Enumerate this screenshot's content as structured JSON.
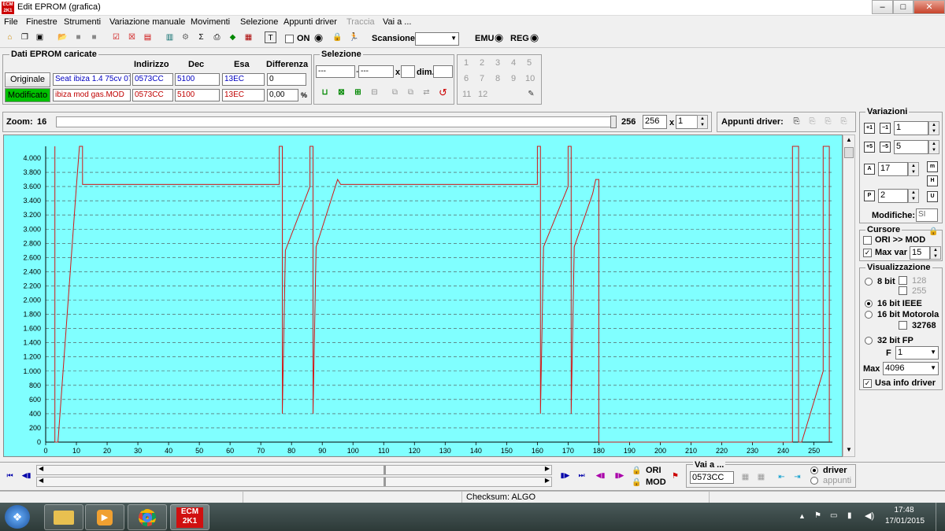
{
  "window": {
    "title": "Edit EPROM (grafica)",
    "app_icon_text": "ECM 2K1"
  },
  "menu": [
    "File",
    "Finestre",
    "Strumenti",
    "Variazione manuale",
    "Movimenti",
    "Selezione",
    "Appunti driver",
    "Traccia",
    "Vai a ..."
  ],
  "toolbar": {
    "on_label": "ON",
    "scansione_label": "Scansione",
    "scansione_value": "",
    "emu_label": "EMU",
    "reg_label": "REG"
  },
  "dati_eprom": {
    "group_title": "Dati EPROM caricate",
    "headers": {
      "indirizzo": "Indirizzo",
      "dec": "Dec",
      "esa": "Esa",
      "differenza": "Differenza"
    },
    "originale": {
      "button": "Originale",
      "file": "Seat ibiza 1.4 75cv 07",
      "indirizzo": "0573CC",
      "dec": "5100",
      "esa": "13EC",
      "differenza": "0"
    },
    "modificato": {
      "button": "Modificato",
      "file": "ibiza mod gas.MOD",
      "indirizzo": "0573CC",
      "dec": "5100",
      "esa": "13EC",
      "differenza": "0,00",
      "unit": "%"
    }
  },
  "selezione": {
    "group_title": "Selezione",
    "from": "---",
    "to": "---",
    "x_label": "x",
    "dim_label": "dim.",
    "numbers": [
      "1",
      "2",
      "3",
      "4",
      "5",
      "6",
      "7",
      "8",
      "9",
      "10",
      "11",
      "12"
    ]
  },
  "zoom": {
    "label": "Zoom:",
    "value": "16",
    "max": "256",
    "field": "256",
    "x_label": "x",
    "multiplier": "1"
  },
  "appunti_driver_label": "Appunti driver:",
  "variazioni": {
    "group_title": "Variazioni",
    "val1": "1",
    "val2": "5",
    "val3": "17",
    "val4": "2",
    "modifiche_label": "Modifiche:",
    "modifiche_value": "SI"
  },
  "cursore": {
    "group_title": "Cursore",
    "ori_mod_label": "ORI >> MOD",
    "ori_mod_checked": false,
    "max_var_label": "Max var",
    "max_var_checked": true,
    "max_var_value": "15"
  },
  "visualizzazione": {
    "group_title": "Visualizzazione",
    "options": [
      {
        "label": "8 bit",
        "selected": false
      },
      {
        "label": "16 bit IEEE",
        "selected": true
      },
      {
        "label": "16 bit Motorola",
        "selected": false
      },
      {
        "label": "32 bit FP",
        "selected": false
      }
    ],
    "chk_128": "128",
    "chk_255": "255",
    "chk_32768": "32768",
    "f_label": "F",
    "f_value": "1",
    "max_label": "Max",
    "max_value": "4096",
    "usa_info_label": "Usa info driver",
    "usa_info_checked": true
  },
  "bottom": {
    "ori_label": "ORI",
    "mod_label": "MOD",
    "vai_a_label": "Vai a ...",
    "vai_a_value": "0573CC",
    "driver_label": "driver",
    "appunti_label": "appunti"
  },
  "status": {
    "checksum": "Checksum: ALGO"
  },
  "taskbar": {
    "time": "17:48",
    "date": "17/01/2015",
    "ecm_label": "ECM 2K1"
  },
  "colors": {
    "plot_bg": "#80ffff",
    "line": "#d01818",
    "grid": "#4a4a4a",
    "modificato_green": "#00c000"
  },
  "chart_data": {
    "type": "line",
    "xlim": [
      0,
      256
    ],
    "ylim": [
      0,
      4100
    ],
    "x_ticks": [
      0,
      10,
      20,
      30,
      40,
      50,
      60,
      70,
      80,
      90,
      100,
      110,
      120,
      130,
      140,
      150,
      160,
      170,
      180,
      190,
      200,
      210,
      220,
      230,
      240,
      250
    ],
    "y_ticks": [
      "0",
      "200",
      "400",
      "600",
      "800",
      "1.000",
      "1.200",
      "1.400",
      "1.600",
      "1.800",
      "2.000",
      "2.200",
      "2.400",
      "2.600",
      "2.800",
      "3.000",
      "3.200",
      "3.400",
      "3.600",
      "3.800",
      "4.000"
    ],
    "grid": "horizontal dashed",
    "series": [
      {
        "values": [
          [
            3,
            4100
          ],
          [
            3,
            0
          ],
          [
            4,
            0
          ],
          [
            10,
            3600
          ],
          [
            11,
            4100
          ],
          [
            12,
            4100
          ],
          [
            12,
            3630
          ],
          [
            76,
            3630
          ],
          [
            76,
            4100
          ],
          [
            77,
            4100
          ],
          [
            77,
            400
          ],
          [
            78,
            2700
          ],
          [
            86,
            3600
          ],
          [
            86,
            4100
          ],
          [
            87,
            4100
          ],
          [
            87,
            400
          ],
          [
            88,
            2750
          ],
          [
            95,
            3700
          ],
          [
            96,
            3630
          ],
          [
            160,
            3630
          ],
          [
            160,
            4100
          ],
          [
            161,
            4100
          ],
          [
            161,
            400
          ],
          [
            162,
            2750
          ],
          [
            170,
            3600
          ],
          [
            170,
            4100
          ],
          [
            171,
            4100
          ],
          [
            171,
            400
          ],
          [
            172,
            2750
          ],
          [
            178,
            3500
          ],
          [
            179,
            3700
          ],
          [
            180,
            3700
          ],
          [
            180,
            0
          ],
          [
            243,
            0
          ],
          [
            243,
            4100
          ],
          [
            245,
            4100
          ],
          [
            245,
            0
          ],
          [
            246,
            0
          ],
          [
            253,
            1000
          ],
          [
            253,
            4100
          ],
          [
            255,
            4100
          ],
          [
            255,
            0
          ]
        ]
      }
    ]
  }
}
